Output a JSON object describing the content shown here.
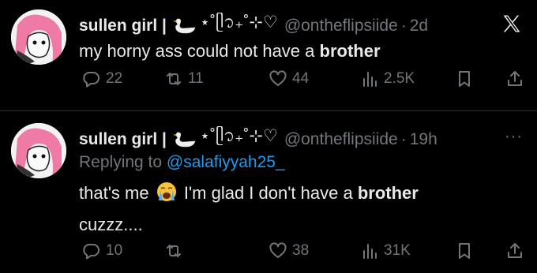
{
  "tweet1": {
    "name": "sullen girl |",
    "decoration": "⋆˚ᥫ᭡₊˚⊹♡",
    "handle": "@ontheflipsiide",
    "dot": "·",
    "time": "2d",
    "text_main": "my horny ass could not have a ",
    "text_bold": "brother",
    "replies": "22",
    "retweets": "11",
    "likes": "44",
    "views": "2.5K"
  },
  "tweet2": {
    "name": "sullen girl |",
    "decoration": "⋆˚ᥫ᭡₊˚⊹♡",
    "handle": "@ontheflipsiide",
    "dot": "·",
    "time": "19h",
    "more": "···",
    "replying_prefix": "Replying to ",
    "replying_handle": "@salafiyyah25_",
    "text_a": "that's me",
    "text_b": "I'm glad I don't have a ",
    "text_bold": "brother",
    "text_line2": "cuzzz....",
    "replies": "10",
    "retweets": "",
    "likes": "38",
    "views": "31K"
  },
  "colors": {
    "background": "#000000",
    "text": "#e7e9ea",
    "muted": "#71767b",
    "link": "#1d9bf0",
    "avatar_hair": "#f07aa6"
  },
  "icons": [
    "x-logo-icon",
    "swan-icon",
    "reply-icon",
    "retweet-icon",
    "heart-icon",
    "views-icon",
    "bookmark-icon",
    "share-icon",
    "crying-emoji-icon",
    "more-icon"
  ]
}
